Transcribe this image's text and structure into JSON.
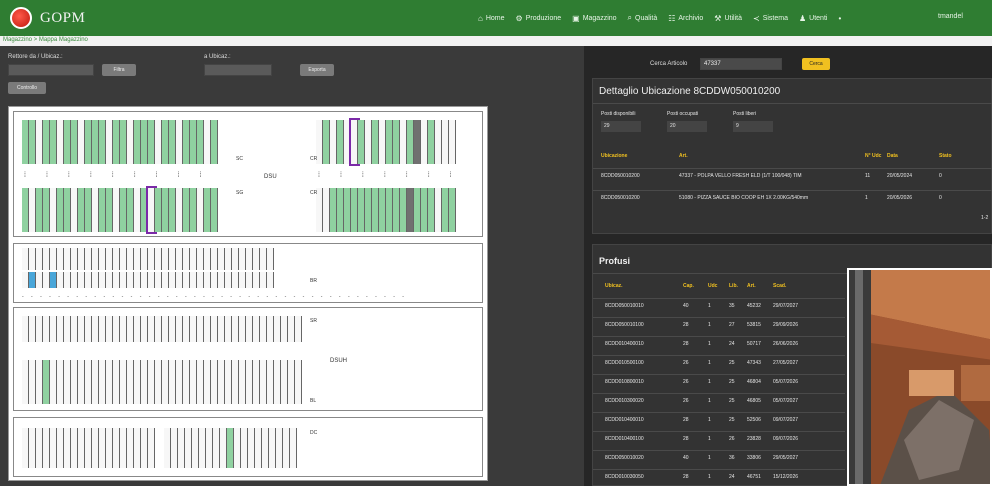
{
  "app": {
    "brand": "GOPM",
    "crumb": "Magazzino > Mappa Magazzino"
  },
  "nav": [
    {
      "icon": "home-icon",
      "glyph": "⌂",
      "label": "Home"
    },
    {
      "icon": "gear-icon",
      "glyph": "⚙",
      "label": "Produzione"
    },
    {
      "icon": "warehouse-icon",
      "glyph": "▣",
      "label": "Magazzino"
    },
    {
      "icon": "search-icon",
      "glyph": "⌕",
      "label": "Qualità"
    },
    {
      "icon": "archive-icon",
      "glyph": "☷",
      "label": "Archivio"
    },
    {
      "icon": "wrench-icon",
      "glyph": "⚒",
      "label": "Utilità"
    },
    {
      "icon": "share-icon",
      "glyph": "≺",
      "label": "Sistema"
    },
    {
      "icon": "users-icon",
      "glyph": "♟",
      "label": "Utenti"
    },
    {
      "icon": "dot",
      "glyph": "•",
      "label": ""
    }
  ],
  "user": "tmandel",
  "filters": {
    "from_label": "Rettore da / Ubicaz.:",
    "to_label": "a Ubicaz.:",
    "from_btn": "Filtra",
    "to_btn": "Esporta",
    "reset_btn": "Controllo"
  },
  "map_labels": {
    "aisle_top": "DSU",
    "aisle_bottom": "DSUH",
    "r1": "SC",
    "r2": "CR",
    "r3": "SG",
    "r4": "CR",
    "r5": "BR",
    "r6": "SR",
    "r7": "BL",
    "r8": "DC"
  },
  "search": {
    "label": "Cerca Articolo",
    "value": "47337",
    "button": "Cerca"
  },
  "detail": {
    "title": "Dettaglio Ubicazione 8CDDW050010200",
    "fields": [
      {
        "label": "Posti disponibili",
        "value": "29"
      },
      {
        "label": "Posti occupati",
        "value": "20"
      },
      {
        "label": "Posti liberi",
        "value": "9"
      }
    ],
    "headers": [
      "Ubicazione",
      "Art.",
      "N° Udc",
      "Data",
      "Stato"
    ],
    "rows": [
      [
        "8CDD050010200",
        "47337 - POLPA VELLO FRESH ELD (1/T 100/048) TIM",
        "11",
        "20/05/2024",
        "0"
      ],
      [
        "8CDD050010200",
        "51080 - PIZZA SAUCE BIO COOP EH 1X 2.00KG/540mm",
        "1",
        "20/05/2026",
        "0"
      ]
    ],
    "pager": "1-2"
  },
  "profili": {
    "title": "Profusi",
    "headers": [
      "Ubicaz.",
      "Cap.",
      "Udc",
      "Lib.",
      "Art.",
      "Scad."
    ],
    "rows": [
      [
        "8CDD050010010",
        "40",
        "1",
        "35",
        "45232",
        "29/07/2027"
      ],
      [
        "8CDD050010100",
        "28",
        "1",
        "27",
        "53815",
        "29/09/2026"
      ],
      [
        "8CDD010400010",
        "28",
        "1",
        "24",
        "50717",
        "26/06/2026"
      ],
      [
        "8CDD010500100",
        "26",
        "1",
        "25",
        "47343",
        "27/05/2027"
      ],
      [
        "8CDD010800010",
        "26",
        "1",
        "25",
        "46804",
        "05/07/2026"
      ],
      [
        "8CDD010300020",
        "26",
        "1",
        "25",
        "46805",
        "05/07/2027"
      ],
      [
        "8CDD010400010",
        "28",
        "1",
        "25",
        "52506",
        "09/07/2027"
      ],
      [
        "8CDD010400100",
        "28",
        "1",
        "26",
        "23828",
        "09/07/2026"
      ],
      [
        "8CDD050010020",
        "40",
        "1",
        "36",
        "33806",
        "29/05/2027"
      ],
      [
        "8CDD010030050",
        "28",
        "1",
        "24",
        "46751",
        "15/12/2026"
      ]
    ]
  },
  "colors": {
    "topbar": "#2f7d32",
    "accent": "#f0c020",
    "occupied": "#8fd1a0",
    "selected": "#7b2aa8"
  }
}
